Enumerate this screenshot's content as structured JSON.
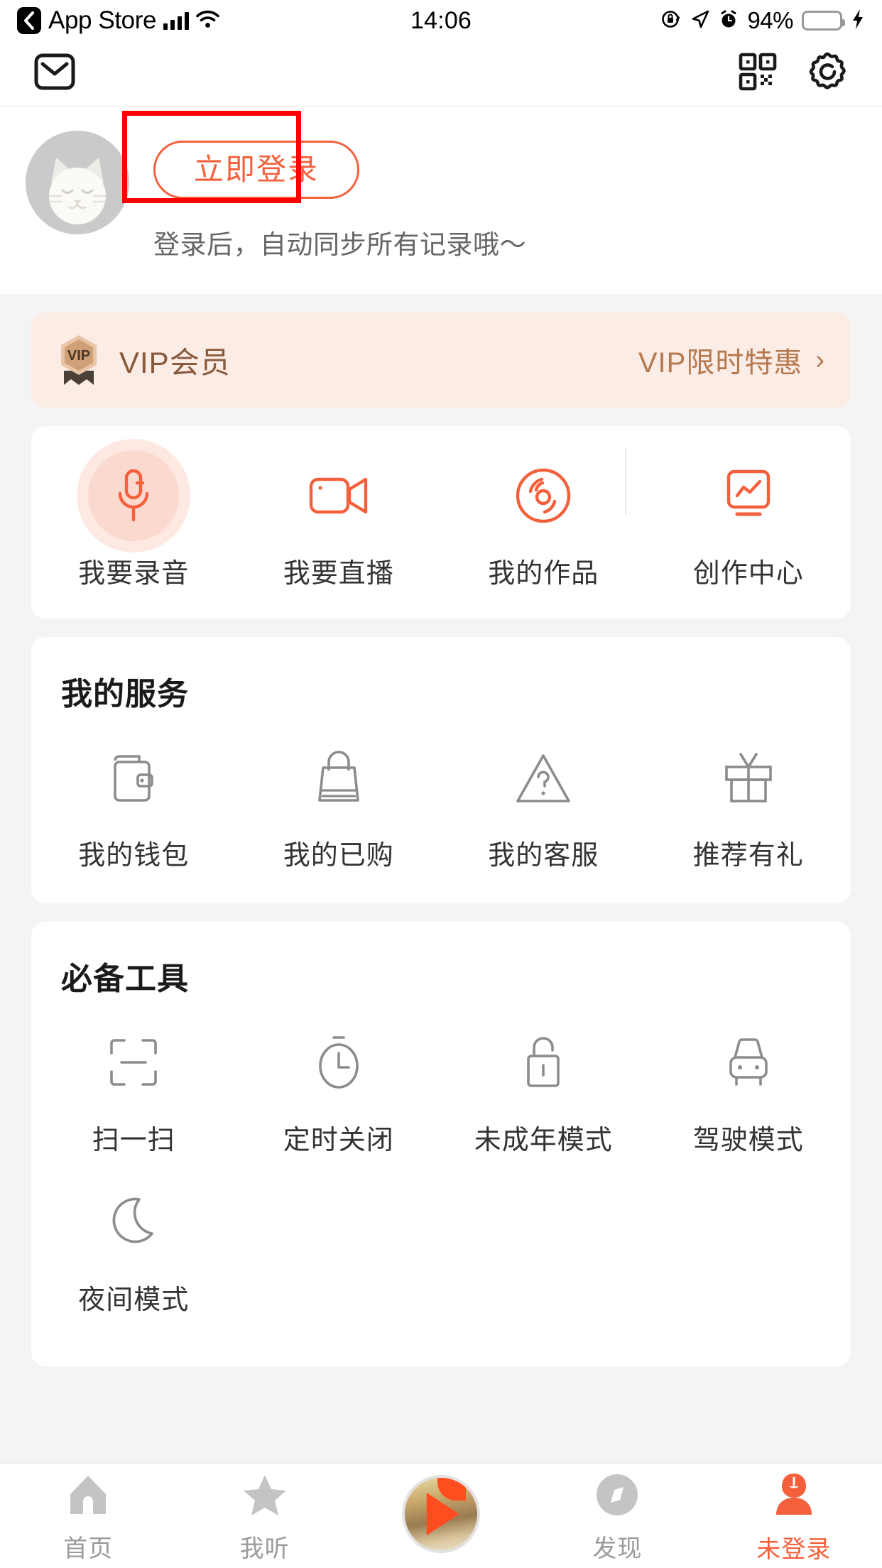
{
  "status_bar": {
    "back_label": "App Store",
    "back_icon": "chevron-left-icon",
    "signal_icon": "cellular-signal-icon",
    "wifi_icon": "wifi-icon",
    "time": "14:06",
    "rotation_lock_icon": "rotation-lock-icon",
    "location_icon": "location-arrow-icon",
    "alarm_icon": "alarm-clock-icon",
    "battery_percent": "94%",
    "battery_icon": "battery-icon",
    "charging_icon": "lightning-bolt-icon",
    "battery_color": "#4cd964"
  },
  "header": {
    "mail_icon": "mail-envelope-icon",
    "qr_icon": "qr-code-icon",
    "settings_icon": "gear-icon"
  },
  "profile": {
    "avatar_icon": "cat-avatar-icon",
    "login_label": "立即登录",
    "subtitle": "登录后，自动同步所有记录哦～",
    "accent_color": "#f4603c",
    "highlight_color": "#ff0000"
  },
  "vip_banner": {
    "badge_icon": "vip-badge-icon",
    "badge_text": "VIP",
    "label": "VIP会员",
    "cta": "VIP限时特惠",
    "chevron": "›",
    "background": "#fcece6",
    "text_color": "#8a5a3c"
  },
  "quick_actions": {
    "items": [
      {
        "label": "我要录音",
        "icon": "microphone-icon"
      },
      {
        "label": "我要直播",
        "icon": "video-camera-icon"
      },
      {
        "label": "我的作品",
        "icon": "vinyl-record-icon"
      },
      {
        "label": "创作中心",
        "icon": "chart-screen-icon"
      }
    ]
  },
  "services": {
    "title": "我的服务",
    "items": [
      {
        "label": "我的钱包",
        "icon": "wallet-icon"
      },
      {
        "label": "我的已购",
        "icon": "shopping-bag-icon"
      },
      {
        "label": "我的客服",
        "icon": "help-triangle-icon"
      },
      {
        "label": "推荐有礼",
        "icon": "gift-icon"
      }
    ]
  },
  "tools": {
    "title": "必备工具",
    "items": [
      {
        "label": "扫一扫",
        "icon": "scan-frame-icon"
      },
      {
        "label": "定时关闭",
        "icon": "timer-clock-icon"
      },
      {
        "label": "未成年模式",
        "icon": "padlock-open-icon"
      },
      {
        "label": "驾驶模式",
        "icon": "car-icon"
      },
      {
        "label": "夜间模式",
        "icon": "crescent-moon-icon"
      }
    ]
  },
  "tab_bar": {
    "items": [
      {
        "label": "首页",
        "icon": "home-icon",
        "active": false
      },
      {
        "label": "我听",
        "icon": "star-icon",
        "active": false
      },
      {
        "label": "",
        "icon": "player-thumbnail-icon",
        "active": false
      },
      {
        "label": "发现",
        "icon": "compass-icon",
        "active": false
      },
      {
        "label": "未登录",
        "icon": "person-icon",
        "active": true
      }
    ],
    "active_color": "#f4603c",
    "inactive_color": "#c4c4c4"
  }
}
